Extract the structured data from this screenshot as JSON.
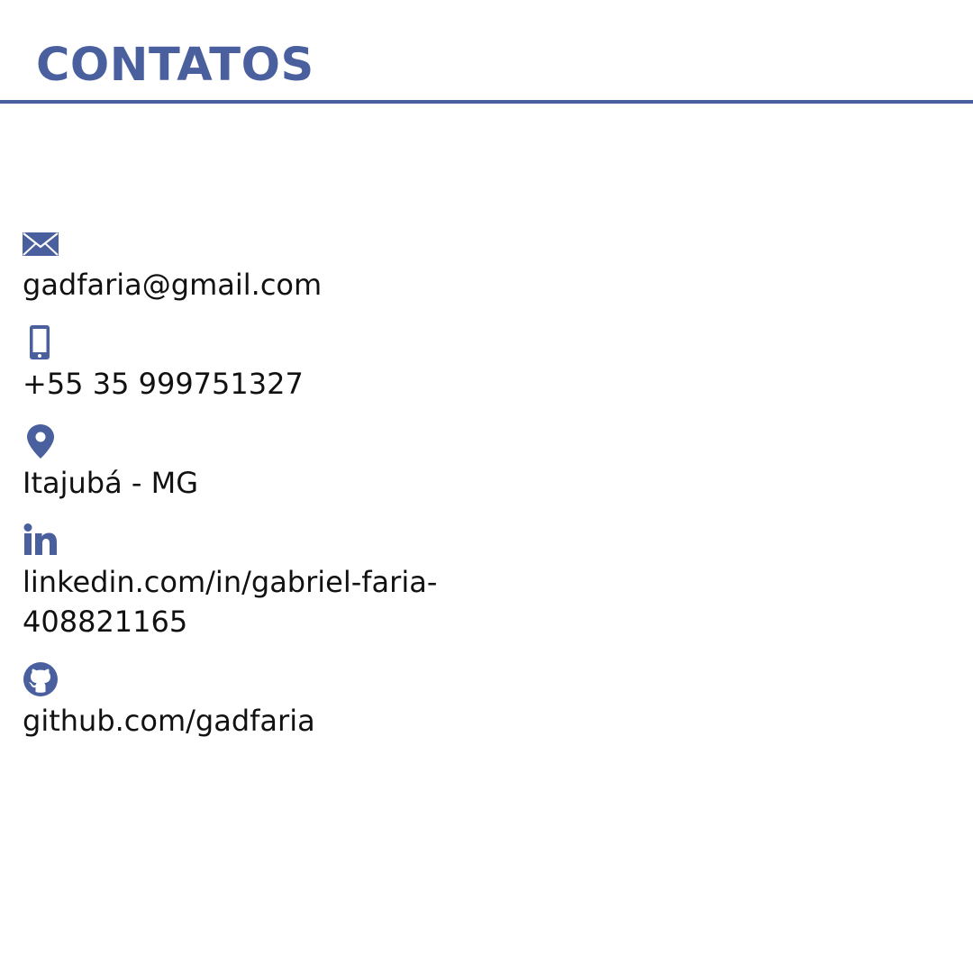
{
  "header": {
    "title": "CONTATOS"
  },
  "colors": {
    "accent": "#4a5f9e",
    "text": "#111111",
    "background": "#ffffff"
  },
  "contacts": [
    {
      "icon": "envelope-icon",
      "text": "gadfaria@gmail.com"
    },
    {
      "icon": "phone-icon",
      "text": "+55 35 999751327"
    },
    {
      "icon": "location-pin-icon",
      "text": "Itajubá - MG"
    },
    {
      "icon": "linkedin-icon",
      "text": "linkedin.com/in/gabriel-faria-408821165"
    },
    {
      "icon": "github-icon",
      "text": "github.com/gadfaria"
    }
  ]
}
